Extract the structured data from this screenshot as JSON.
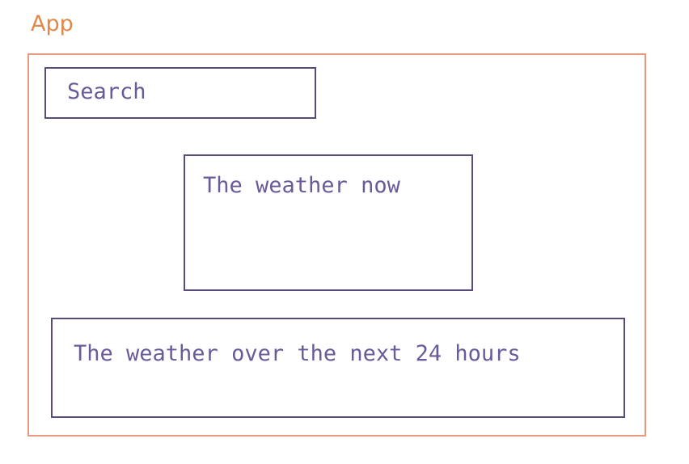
{
  "app": {
    "label": "App"
  },
  "components": {
    "search": "Search",
    "current_weather": "The weather now",
    "forecast": "The weather over the next 24 hours"
  },
  "colors": {
    "app_label": "#e0884a",
    "app_border": "#e59a7f",
    "component_border": "#5a4a7c",
    "component_text": "#6b5a98"
  }
}
